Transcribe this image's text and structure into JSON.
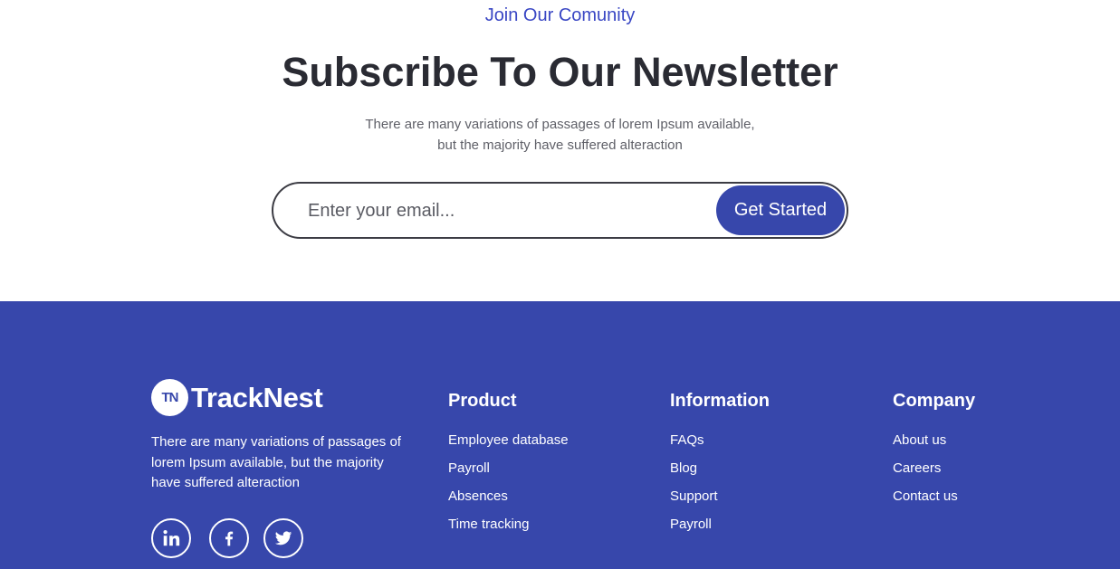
{
  "newsletter": {
    "eyebrow": "Join Our Comunity",
    "title": "Subscribe To Our Newsletter",
    "description_line1": "There are many variations of passages of lorem Ipsum available,",
    "description_line2": "but the majority have suffered alteraction",
    "email_placeholder": "Enter your email...",
    "email_value": "",
    "cta_label": "Get Started"
  },
  "footer": {
    "brand": {
      "mark": "TN",
      "name": "TrackNest"
    },
    "about": "There are many variations of passages of lorem Ipsum available, but the majority have suffered alteraction",
    "social": [
      {
        "icon": "linkedin-icon"
      },
      {
        "icon": "facebook-icon"
      },
      {
        "icon": "twitter-icon"
      }
    ],
    "columns": [
      {
        "title": "Product",
        "links": [
          "Employee database",
          "Payroll",
          "Absences",
          "Time tracking"
        ]
      },
      {
        "title": "Information",
        "links": [
          "FAQs",
          "Blog",
          "Support",
          "Payroll"
        ]
      },
      {
        "title": "Company",
        "links": [
          "About us",
          "Careers",
          "Contact us"
        ]
      }
    ]
  },
  "colors": {
    "brand_blue": "#3747ab",
    "accent_link": "#3a47c4",
    "heading": "#2a2b33",
    "muted_text": "#5f6068",
    "white": "#ffffff"
  }
}
